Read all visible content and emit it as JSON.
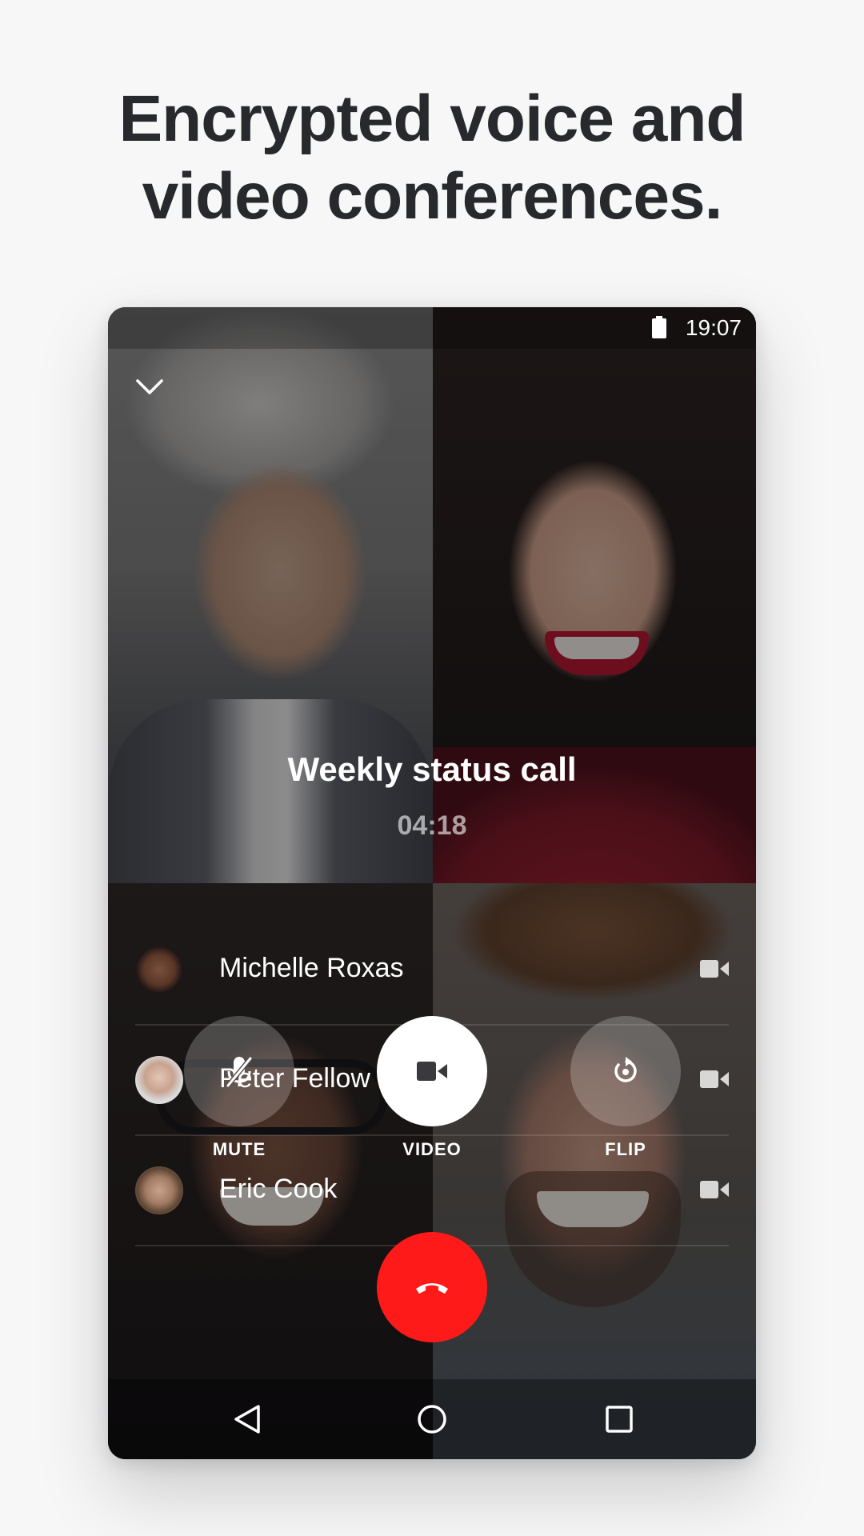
{
  "headline": {
    "line1": "Encrypted voice and",
    "line2": "video conferences."
  },
  "status_bar": {
    "time": "19:07",
    "battery_icon": "battery-full-icon"
  },
  "call": {
    "title": "Weekly status call",
    "timer": "04:18",
    "collapse_icon": "chevron-down-icon"
  },
  "participants": [
    {
      "name": "Michelle Roxas",
      "avatar": "avatar-michelle",
      "media_icon": "video-camera-icon"
    },
    {
      "name": "Peter Fellow",
      "avatar": "avatar-peter",
      "media_icon": "video-camera-icon"
    },
    {
      "name": "Eric Cook",
      "avatar": "avatar-eric",
      "media_icon": "video-camera-icon"
    }
  ],
  "controls": {
    "mute_label": "MUTE",
    "video_label": "VIDEO",
    "flip_label": "FLIP",
    "mute_icon": "microphone-off-icon",
    "video_icon": "video-camera-icon",
    "flip_icon": "rotate-camera-icon",
    "hangup_icon": "phone-hangup-icon"
  },
  "navbar": {
    "back_icon": "back-triangle-icon",
    "home_icon": "home-circle-icon",
    "recents_icon": "recents-square-icon"
  },
  "colors": {
    "background": "#f7f7f8",
    "headline": "#27292d",
    "hangup": "#ff1a1a",
    "video_button": "#ffffff"
  }
}
